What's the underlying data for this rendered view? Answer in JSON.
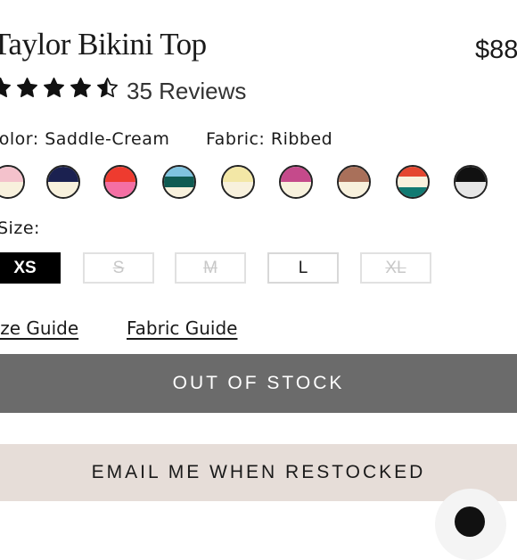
{
  "product": {
    "title": "Taylor Bikini Top",
    "price": "$88",
    "rating": 4.5,
    "reviews_label": "35 Reviews"
  },
  "options": {
    "color_label": "Color: Saddle-Cream",
    "fabric_label": "Fabric: Ribbed",
    "swatches": [
      {
        "name": "pink-cream",
        "top": "#f4c2cc",
        "bottom": "#f8f1dd"
      },
      {
        "name": "navy-cream",
        "top": "#1b2150",
        "bottom": "#f8f1dd"
      },
      {
        "name": "red-pink",
        "top": "#ee3b2f",
        "bottom": "#f46fa4"
      },
      {
        "name": "lightblue-green-cream",
        "top": "#7fc3df",
        "middle": "#0f5b52",
        "bottom": "#f8f1dd"
      },
      {
        "name": "yellow-cream",
        "top": "#f3e7a6",
        "bottom": "#f8f1dd"
      },
      {
        "name": "magenta-cream",
        "top": "#c54a8b",
        "bottom": "#f8f1dd"
      },
      {
        "name": "saddle-cream",
        "top": "#a9705a",
        "bottom": "#f8f1dd"
      },
      {
        "name": "red-cream-teal",
        "top": "#e44730",
        "middle": "#f8f1dd",
        "bottom": "#117a72"
      },
      {
        "name": "black-white",
        "top": "#111111",
        "bottom": "#e6e6e6"
      }
    ],
    "size_label": "Size:",
    "sizes": [
      {
        "label": "XS",
        "state": "selected"
      },
      {
        "label": "S",
        "state": "unavailable"
      },
      {
        "label": "M",
        "state": "unavailable"
      },
      {
        "label": "L",
        "state": "available"
      },
      {
        "label": "XL",
        "state": "unavailable"
      }
    ],
    "size_guide_label": "Size Guide",
    "fabric_guide_label": "Fabric Guide"
  },
  "actions": {
    "out_of_stock_label": "OUT OF STOCK",
    "restock_label": "EMAIL ME WHEN RESTOCKED"
  },
  "icons": {
    "star": "star-icon",
    "chat": "chat-icon"
  }
}
